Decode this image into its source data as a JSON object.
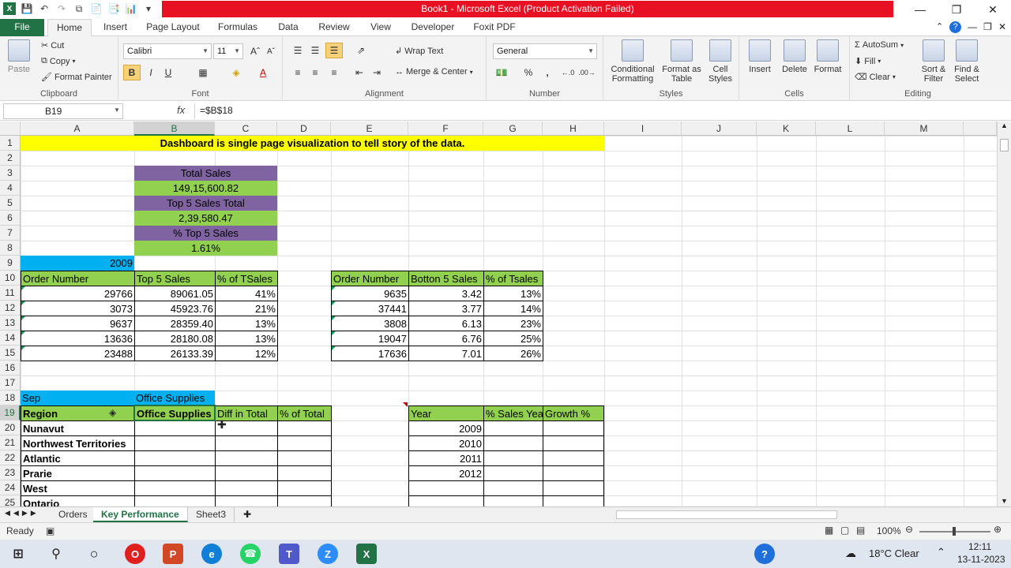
{
  "window": {
    "title": "Book1  -  Microsoft Excel (Product Activation Failed)"
  },
  "tabs": [
    "File",
    "Home",
    "Insert",
    "Page Layout",
    "Formulas",
    "Data",
    "Review",
    "View",
    "Developer",
    "Foxit PDF"
  ],
  "ribbon": {
    "clipboard": {
      "label": "Clipboard",
      "paste": "Paste",
      "cut": "Cut",
      "copy": "Copy",
      "format_painter": "Format Painter"
    },
    "font": {
      "label": "Font",
      "name": "Calibri",
      "size": "11",
      "bold": "B",
      "italic": "I",
      "underline": "U"
    },
    "alignment": {
      "label": "Alignment",
      "wrap": "Wrap Text",
      "merge": "Merge & Center"
    },
    "number": {
      "label": "Number",
      "format": "General",
      "percent": "%",
      "comma": ","
    },
    "styles": {
      "label": "Styles",
      "conditional": "Conditional Formatting",
      "format_table": "Format as Table",
      "cell_styles": "Cell Styles"
    },
    "cells": {
      "label": "Cells",
      "insert": "Insert",
      "delete": "Delete",
      "format": "Format"
    },
    "editing": {
      "label": "Editing",
      "autosum": "AutoSum",
      "fill": "Fill",
      "clear": "Clear",
      "sort": "Sort & Filter",
      "find": "Find & Select"
    }
  },
  "formula_bar": {
    "name_box": "B19",
    "fx": "fx",
    "formula": "=$B$18"
  },
  "columns": [
    "A",
    "B",
    "C",
    "D",
    "E",
    "F",
    "G",
    "H",
    "I",
    "J",
    "K",
    "L",
    "M"
  ],
  "rows": [
    "1",
    "2",
    "3",
    "4",
    "5",
    "6",
    "7",
    "8",
    "9",
    "10",
    "11",
    "12",
    "13",
    "14",
    "15",
    "16",
    "17",
    "18",
    "19",
    "20",
    "21",
    "22",
    "23",
    "24",
    "25"
  ],
  "cells": {
    "banner": "Dashboard is single page visualization to tell story of the data.",
    "total_sales_label": "Total Sales",
    "total_sales_value": "149,15,600.82",
    "top5_total_label": "Top 5 Sales Total",
    "top5_total_value": "2,39,580.47",
    "top5_pct_label": "% Top 5 Sales",
    "top5_pct_value": "1.61%",
    "year": "2009",
    "top_headers": [
      "Order Number",
      "Top 5 Sales",
      "% of TSales"
    ],
    "top_rows": [
      [
        "29766",
        "89061.05",
        "41%"
      ],
      [
        "3073",
        "45923.76",
        "21%"
      ],
      [
        "9637",
        "28359.40",
        "13%"
      ],
      [
        "13636",
        "28180.08",
        "13%"
      ],
      [
        "23488",
        "26133.39",
        "12%"
      ]
    ],
    "bottom_headers": [
      "Order Number",
      "Botton 5 Sales",
      "% of Tsales"
    ],
    "bottom_rows": [
      [
        "9635",
        "3.42",
        "13%"
      ],
      [
        "37441",
        "3.77",
        "14%"
      ],
      [
        "3808",
        "6.13",
        "23%"
      ],
      [
        "19047",
        "6.76",
        "25%"
      ],
      [
        "17636",
        "7.01",
        "26%"
      ]
    ],
    "month": "Sep",
    "category": "Office Supplies",
    "region_headers": [
      "Region",
      "Office Supplies",
      "Diff in Total",
      "% of Total"
    ],
    "regions": [
      "Nunavut",
      "Northwest Territories",
      "Atlantic",
      "Prarie",
      "West",
      "Ontario"
    ],
    "year_headers": [
      "Year",
      "% Sales Yea",
      "Growth %"
    ],
    "years": [
      "2009",
      "2010",
      "2011",
      "2012"
    ]
  },
  "sheets": [
    "Orders",
    "Key Performance",
    "Sheet3"
  ],
  "status": {
    "ready": "Ready",
    "zoom": "100%"
  },
  "taskbar": {
    "weather": "18°C  Clear",
    "time": "12:11",
    "date": "13-11-2023"
  }
}
